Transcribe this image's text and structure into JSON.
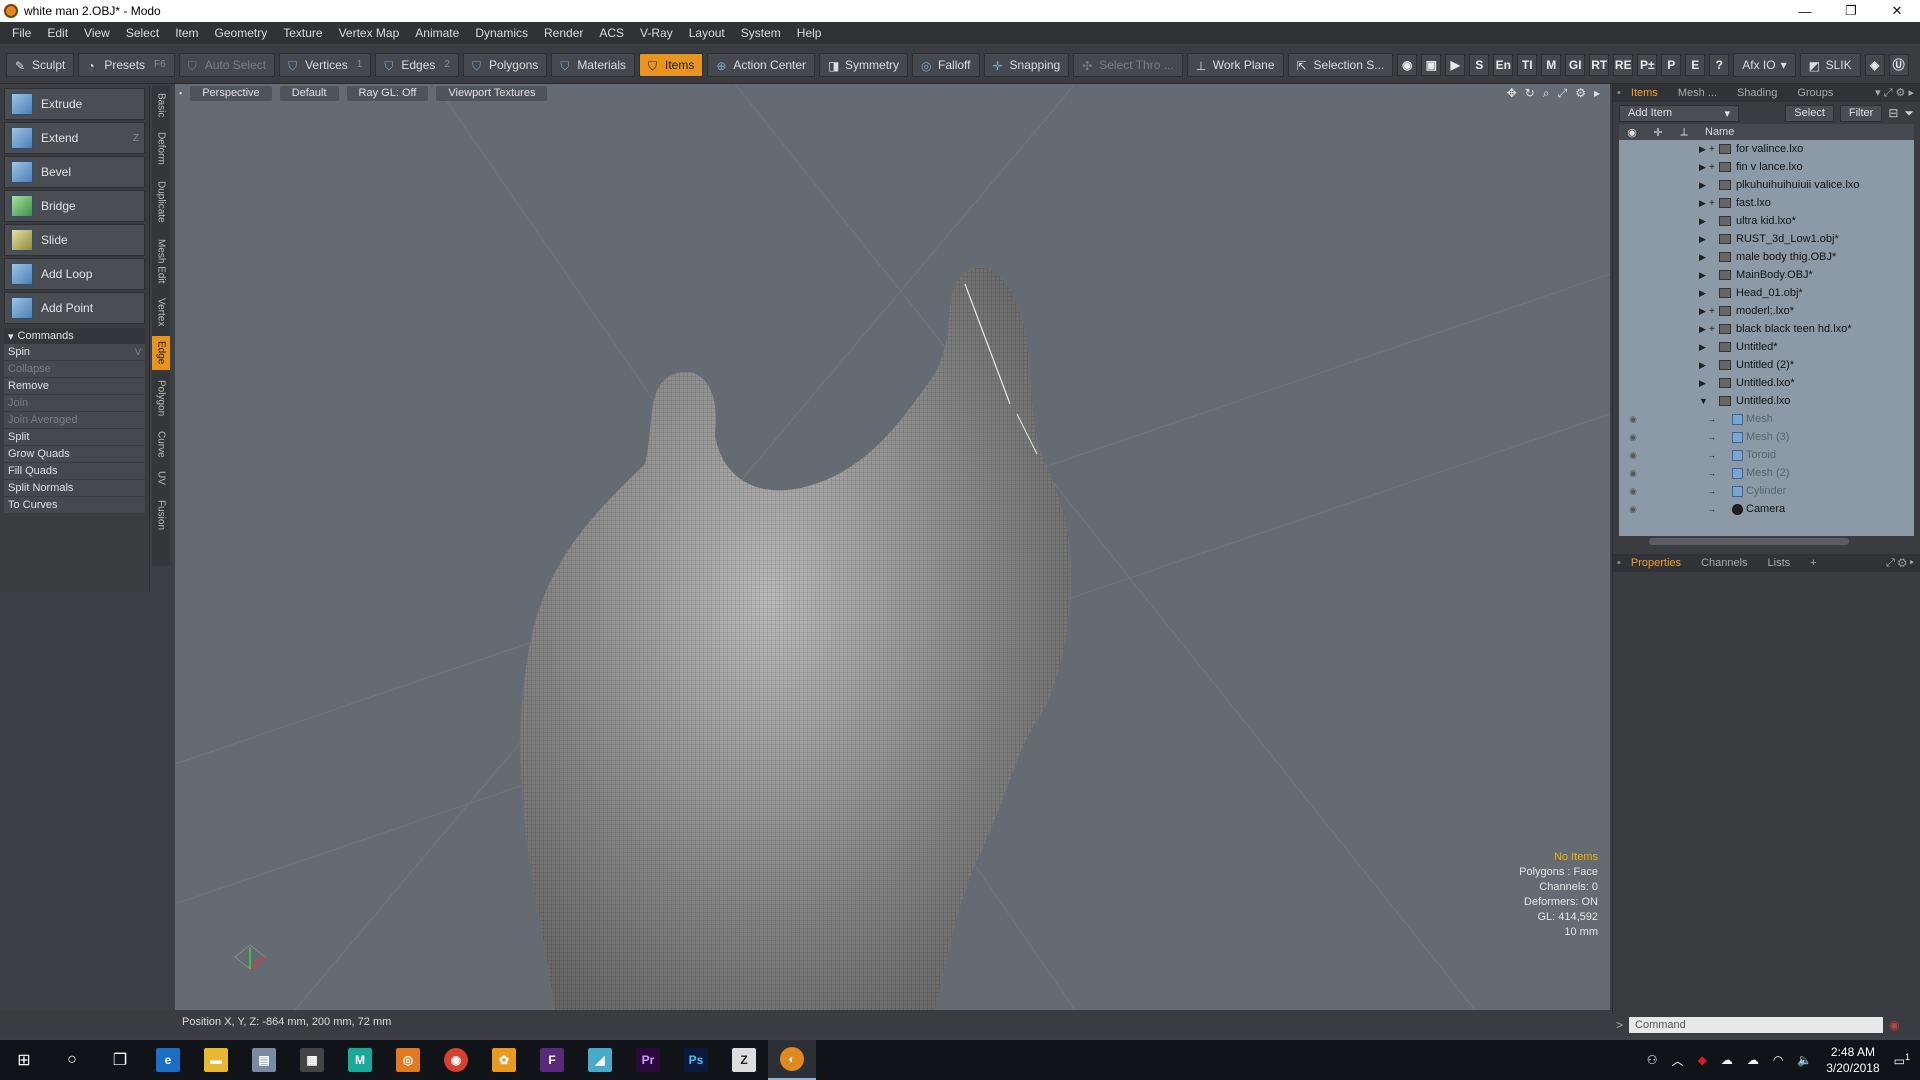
{
  "window": {
    "title": "white man 2.OBJ* - Modo",
    "controls": [
      "—",
      "❐",
      "✕"
    ]
  },
  "menu": [
    "File",
    "Edit",
    "View",
    "Select",
    "Item",
    "Geometry",
    "Texture",
    "Vertex Map",
    "Animate",
    "Dynamics",
    "Render",
    "ACS",
    "V-Ray",
    "Layout",
    "System",
    "Help"
  ],
  "toolbar": {
    "sculpt": "Sculpt",
    "presets": "Presets",
    "presets_key": "F6",
    "auto_select": "Auto Select",
    "vertices": "Vertices",
    "vertices_num": "1",
    "edges": "Edges",
    "edges_num": "2",
    "polygons": "Polygons",
    "materials": "Materials",
    "items": "Items",
    "action_center": "Action Center",
    "symmetry": "Symmetry",
    "falloff": "Falloff",
    "snapping": "Snapping",
    "select_thro": "Select Thro ...",
    "work_plane": "Work Plane",
    "selection_s": "Selection S...",
    "right_labels": [
      "S",
      "En",
      "TI",
      "M",
      "GI",
      "RT",
      "RE",
      "P±",
      "P",
      "E",
      "?"
    ],
    "afx_io": "Afx IO",
    "slik": "SLIK"
  },
  "tools": [
    {
      "label": "Extrude",
      "key": ""
    },
    {
      "label": "Extend",
      "key": "Z"
    },
    {
      "label": "Bevel",
      "key": ""
    },
    {
      "label": "Bridge",
      "key": ""
    },
    {
      "label": "Slide",
      "key": ""
    },
    {
      "label": "Add Loop",
      "key": ""
    },
    {
      "label": "Add Point",
      "key": ""
    }
  ],
  "commands_header": "Commands",
  "commands": [
    {
      "label": "Spin",
      "key": "V",
      "enabled": true
    },
    {
      "label": "Collapse",
      "key": "",
      "enabled": false
    },
    {
      "label": "Remove",
      "key": "",
      "enabled": true
    },
    {
      "label": "Join",
      "key": "",
      "enabled": false
    },
    {
      "label": "Join Averaged",
      "key": "",
      "enabled": false
    },
    {
      "label": "Split",
      "key": "",
      "enabled": true
    },
    {
      "label": "Grow Quads",
      "key": "",
      "enabled": true
    },
    {
      "label": "Fill Quads",
      "key": "",
      "enabled": true
    },
    {
      "label": "Split Normals",
      "key": "",
      "enabled": true
    },
    {
      "label": "To Curves",
      "key": "",
      "enabled": true
    }
  ],
  "vtabs": [
    "Basic",
    "Deform",
    "Duplicate",
    "Mesh Edit",
    "Vertex",
    "Edge",
    "Polygon",
    "Curve",
    "UV",
    "Fusion"
  ],
  "vtab_active": "Edge",
  "viewport": {
    "view": "Perspective",
    "shading": "Default",
    "raygl": "Ray GL: Off",
    "textures": "Viewport Textures",
    "hud": {
      "no_items": "No Items",
      "polygons": "Polygons : Face",
      "channels": "Channels: 0",
      "deformers": "Deformers: ON",
      "gl": "GL: 414,592",
      "unit": "10 mm"
    },
    "position": "Position X, Y, Z:   -864 mm, 200 mm, 72 mm"
  },
  "items_panel": {
    "tabs": [
      "Items",
      "Mesh ...",
      "Shading",
      "Groups"
    ],
    "add_item": "Add Item",
    "select": "Select",
    "filter": "Filter",
    "name_col": "Name",
    "scenes": [
      {
        "label": "for valince.lxo",
        "plus": true
      },
      {
        "label": "fin v lance.lxo",
        "plus": true
      },
      {
        "label": "plkuhuihuihuiuii valice.lxo",
        "plus": false
      },
      {
        "label": "fast.lxo",
        "plus": true
      },
      {
        "label": "ultra kid.lxo*",
        "plus": false
      },
      {
        "label": "RUST_3d_Low1.obj*",
        "plus": false
      },
      {
        "label": "male body thig.OBJ*",
        "plus": false
      },
      {
        "label": "MainBody.OBJ*",
        "plus": false
      },
      {
        "label": "Head_01.obj*",
        "plus": false
      },
      {
        "label": "moderl;.lxo*",
        "plus": true
      },
      {
        "label": "black black teen hd.lxo*",
        "plus": true
      },
      {
        "label": "Untitled*",
        "plus": false
      },
      {
        "label": "Untitled (2)*",
        "plus": false
      },
      {
        "label": "Untitled.lxo*",
        "plus": false
      },
      {
        "label": "Untitled.lxo",
        "plus": false,
        "expanded": true
      }
    ],
    "children": [
      "Mesh",
      "Mesh (3)",
      "Toroid",
      "Mesh (2)",
      "Cylinder",
      "Camera"
    ]
  },
  "properties_tabs": [
    "Properties",
    "Channels",
    "Lists",
    "+"
  ],
  "command_placeholder": "Command",
  "taskbar": {
    "time": "2:48 AM",
    "date": "3/20/2018",
    "notification_count": "1"
  },
  "colors": {
    "accent": "#e8951f",
    "viewport_bg": "#646b73",
    "list_bg": "#8c9aa8"
  }
}
